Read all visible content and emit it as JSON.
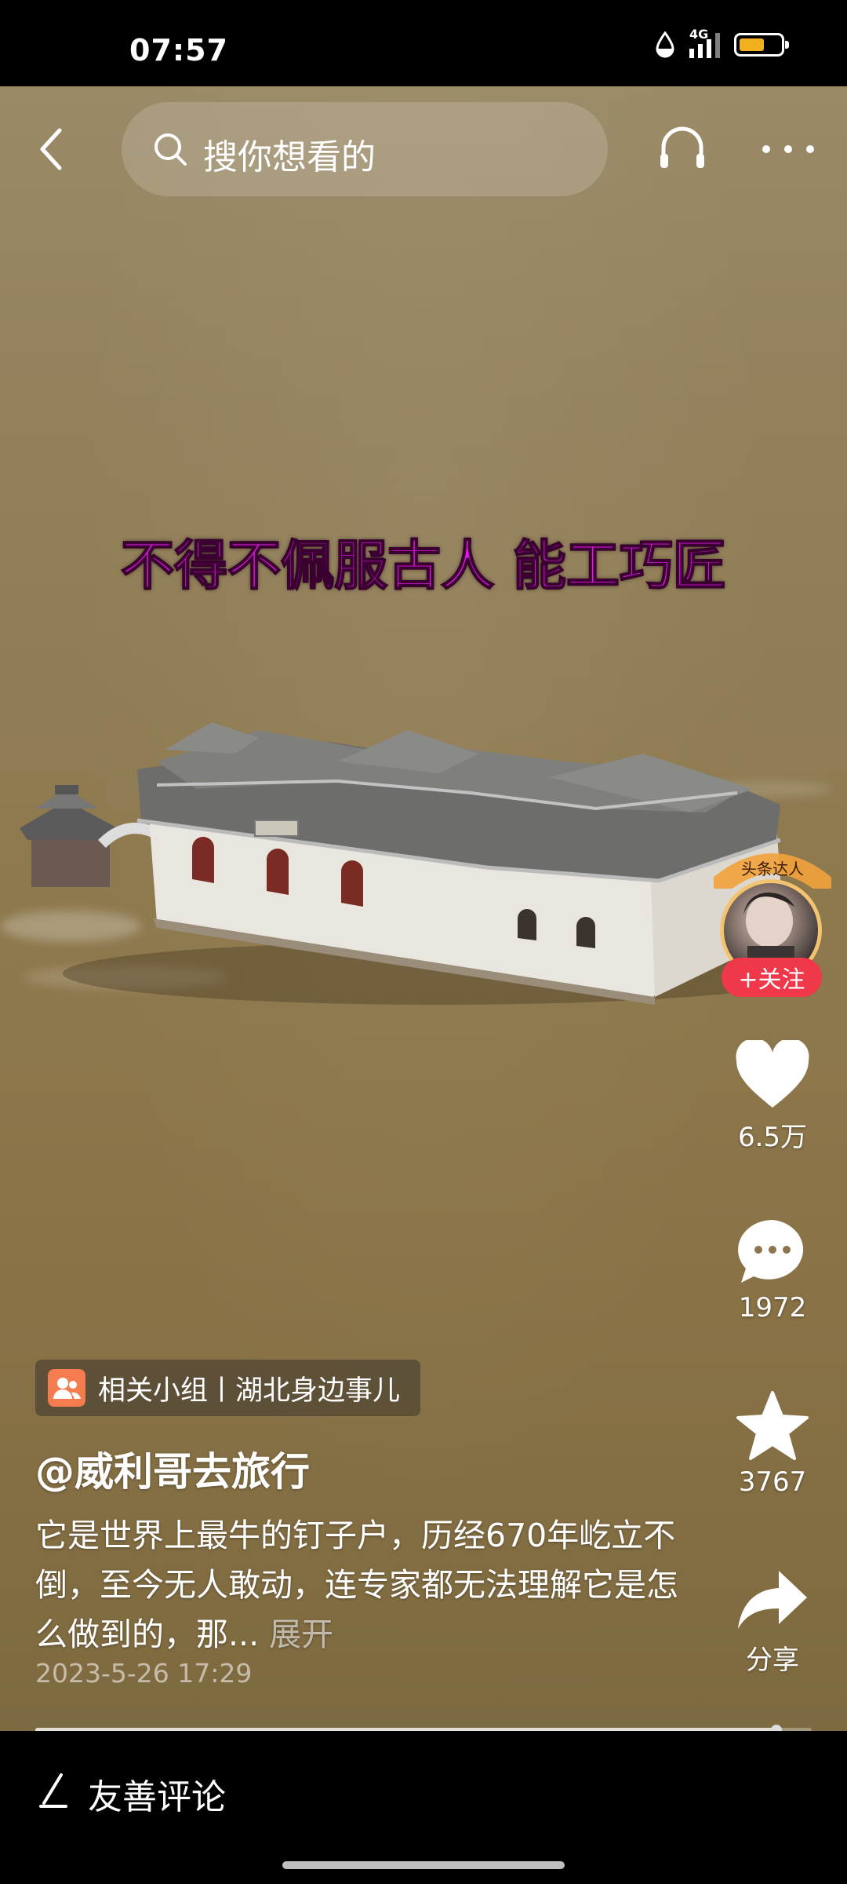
{
  "status_bar": {
    "time": "07:57",
    "network": "4G",
    "battery_level": 0.62,
    "battery_color": "#f2b01e"
  },
  "nav": {
    "back_icon": "chevron-left-icon",
    "search_placeholder": "搜你想看的",
    "headset_icon": "headset-icon",
    "more_icon": "more-dots-icon"
  },
  "video": {
    "caption": "不得不佩服古人 能工巧匠",
    "caption_color": "#e018e8",
    "progress": 0.955
  },
  "author_panel": {
    "badge_text": "头条达人",
    "follow_label": "+关注"
  },
  "actions": {
    "like_count": "6.5万",
    "comment_count": "1972",
    "favorite_count": "3767",
    "share_label": "分享"
  },
  "post": {
    "group_tag": "相关小组丨湖北身边事儿",
    "author": "@威利哥去旅行",
    "description": "它是世界上最牛的钉子户，历经670年屹立不倒，至今无人敢动，连专家都无法理解它是怎么做到的，那...",
    "expand_label": "展开",
    "date": "2023-5-26 17:29"
  },
  "comment_bar": {
    "placeholder": "友善评论"
  },
  "colors": {
    "follow_red": "#f0384b",
    "group_orange": "#f47c4e"
  }
}
